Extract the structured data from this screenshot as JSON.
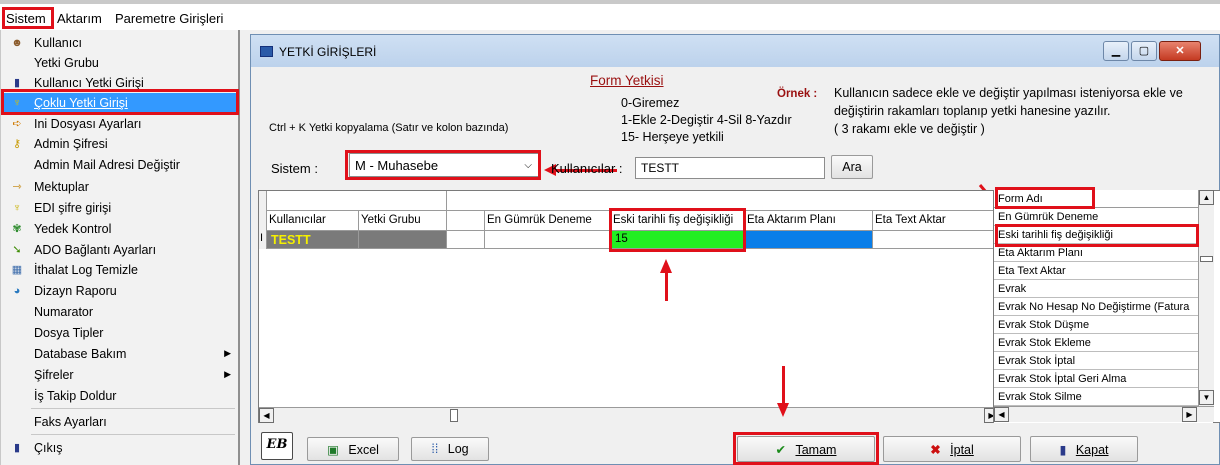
{
  "menubar": {
    "items": [
      "Sistem",
      "Aktarım",
      "Paremetre Girişleri"
    ]
  },
  "menu": {
    "items": [
      {
        "label": "Kullanıcı",
        "icon": "user-icon"
      },
      {
        "label": "Yetki Grubu",
        "icon": ""
      },
      {
        "label": "Kullanıcı Yetki Girişi",
        "icon": "user-key-icon"
      },
      {
        "label": "Çoklu Yetki Girişi",
        "icon": "multi-key-icon"
      },
      {
        "label": "Ini Dosyası  Ayarları",
        "icon": "ini-file-icon"
      },
      {
        "label": "Admin Şifresi",
        "icon": "key-icon"
      },
      {
        "label": "Admin Mail Adresi Değiştir",
        "icon": ""
      },
      {
        "label": "Mektuplar",
        "icon": "letter-icon"
      },
      {
        "label": "EDI şifre girişi",
        "icon": "edi-key-icon"
      },
      {
        "label": "Yedek Kontrol",
        "icon": "backup-icon"
      },
      {
        "label": "ADO Bağlantı Ayarları",
        "icon": "connection-icon"
      },
      {
        "label": "İthalat Log Temizle",
        "icon": "log-clean-icon"
      },
      {
        "label": "Dizayn Raporu",
        "icon": "report-icon"
      },
      {
        "label": "Numarator",
        "icon": ""
      },
      {
        "label": "Dosya Tipler",
        "icon": ""
      },
      {
        "label": "Database Bakım",
        "icon": "",
        "submenu": true
      },
      {
        "label": "Şifreler",
        "icon": "",
        "submenu": true
      },
      {
        "label": "İş Takip Doldur",
        "icon": ""
      },
      {
        "label": "Faks Ayarları",
        "icon": ""
      },
      {
        "label": "Çıkış",
        "icon": "exit-icon"
      }
    ]
  },
  "window": {
    "title": "YETKİ GİRİŞLERİ",
    "form_title": "Form Yetkisi",
    "codes": [
      "0-Giremez",
      "1-Ekle  2-Degiştir  4-Sil  8-Yazdır",
      "15- Herşeye yetkili"
    ],
    "ornek_label": "Örnek :",
    "ornek_text": [
      "Kullanıcın sadece ekle ve değiştir yapılması isteniyorsa  ekle ve",
      "değiştirin rakamları toplanıp yetki hanesine yazılır.",
      " ( 3 rakamı ekle ve değiştir )"
    ],
    "ctrl_hint": "Ctrl + K Yetki kopyalama (Satır ve kolon bazında)",
    "sistem_label": "Sistem :",
    "sistem_value": "M - Muhasebe",
    "kullanicilar_label": "Kullanıcılar :",
    "kullanici_value": "TESTT",
    "ara_label": "Ara"
  },
  "grid": {
    "columns": [
      "Kullanıcılar",
      "Yetki Grubu",
      "",
      "En Gümrük Deneme",
      "Eski tarihli fiş değişikliği",
      "Eta Aktarım Planı",
      "Eta Text Aktar"
    ],
    "row_marker": "I",
    "row": {
      "user": "TESTT",
      "group": "",
      "value": "15"
    }
  },
  "form_list": {
    "header": "Form Adı",
    "items": [
      "En Gümrük Deneme",
      "Eski tarihli fiş değişikliği",
      "Eta Aktarım Planı",
      "Eta Text Aktar",
      "Evrak",
      "Evrak No Hesap No Değiştirme (Fatura",
      "Evrak Stok Düşme",
      "Evrak Stok Ekleme",
      "Evrak Stok İptal",
      "Evrak Stok İptal Geri Alma",
      "Evrak Stok Silme"
    ]
  },
  "buttons": {
    "logo": "EB",
    "excel": "Excel",
    "log": "Log",
    "tamam": "Tamam",
    "iptal": "İptal",
    "kapat": "Kapat"
  },
  "colors": {
    "highlight_red": "#e0101a",
    "selected_blue": "#3399ff",
    "cell_green": "#22ee22",
    "cell_blue": "#0a7ee8",
    "user_yellow": "#f5f000"
  }
}
